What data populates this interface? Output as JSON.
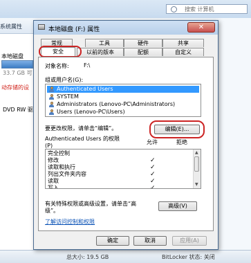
{
  "background": {
    "search_placeholder": "搜索 计算机",
    "command_item": "系统属性",
    "section_header": "本地磁盘 (C:)",
    "drive_name": "本地磁盘",
    "drive_size": "33.7 GB 可",
    "removable_label": "动存储的设",
    "dvd_label": "DVD RW 驱",
    "status_total": "总大小: 19.5 GB",
    "status_bitlocker": "BitLocker 状态: 关闭"
  },
  "dialog": {
    "title": "本地磁盘 (F:) 属性",
    "close_symbol": "✕",
    "tabs_row1": [
      "常规",
      "工具",
      "硬件",
      "共享"
    ],
    "tabs_row2": [
      "安全",
      "以前的版本",
      "配额",
      "自定义"
    ],
    "active_tab": "安全",
    "object_label": "对象名称:",
    "object_value": "F:\\",
    "group_label": "组或用户名(G):",
    "users": [
      "Authenticated Users",
      "SYSTEM",
      "Administrators (Lenovo-PC\\Administrators)",
      "Users (Lenovo-PC\\Users)"
    ],
    "change_hint": "要更改权限，请单击“编辑”。",
    "edit_button": "编辑(E)...",
    "perm_title": "Authenticated Users 的权限",
    "perm_title_suffix": "(P)",
    "allow_header": "允许",
    "deny_header": "拒绝",
    "permissions": [
      {
        "name": "完全控制",
        "allow": ""
      },
      {
        "name": "修改",
        "allow": "✓"
      },
      {
        "name": "读取和执行",
        "allow": "✓"
      },
      {
        "name": "列出文件夹内容",
        "allow": "✓"
      },
      {
        "name": "读取",
        "allow": "✓"
      },
      {
        "name": "写入",
        "allow": "✓"
      }
    ],
    "advanced_hint_1": "有关特殊权限或高级设置，请单击“高",
    "advanced_hint_2": "级”。",
    "advanced_button": "高级(V)",
    "learn_link": "了解访问控制和权限",
    "ok_button": "确定",
    "cancel_button": "取消",
    "apply_button": "应用(A)"
  }
}
